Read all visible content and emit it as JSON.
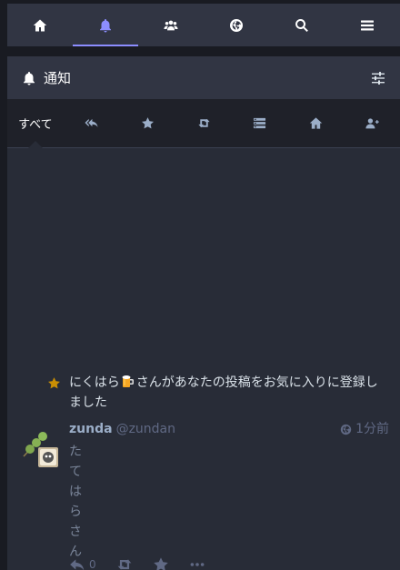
{
  "nav": {
    "tabs": [
      {
        "icon": "home-icon"
      },
      {
        "icon": "bell-icon",
        "active": true
      },
      {
        "icon": "users-icon"
      },
      {
        "icon": "globe-icon"
      },
      {
        "icon": "search-icon"
      },
      {
        "icon": "menu-icon"
      }
    ],
    "accent": "#8c8dff"
  },
  "column": {
    "title": "通知",
    "filters": {
      "all_label": "すべて"
    }
  },
  "notification": {
    "message_before": "にくはら",
    "message_after": "さんがあなたの投稿をお気に入りに登録しました",
    "star_color": "#ca8f04",
    "status": {
      "display_name": "zunda",
      "acct": "@zundan",
      "time": "1分前",
      "content": "たてはらさん",
      "reply_count": "0"
    }
  }
}
